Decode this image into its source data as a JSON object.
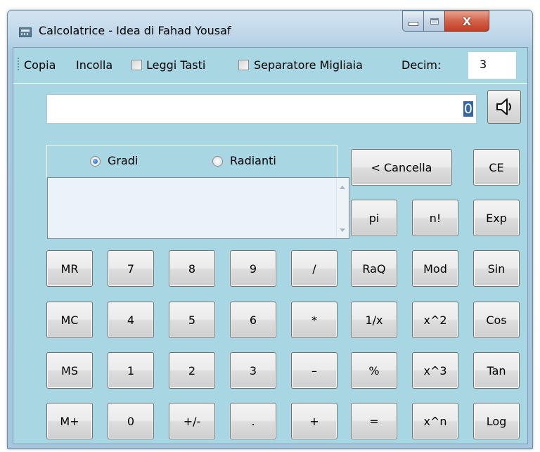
{
  "window": {
    "title": "Calcolatrice - Idea di Fahad Yousaf"
  },
  "window_controls": {
    "minimize_icon": "minimize-icon",
    "maximize_icon": "maximize-icon",
    "close_glyph": "X"
  },
  "toolbar": {
    "copy": "Copia",
    "paste": "Incolla",
    "read_keys": "Leggi Tasti",
    "read_keys_checked": false,
    "thousands_separator": "Separatore Migliaia",
    "thousands_separator_checked": false,
    "decimals_label": "Decim:",
    "decimals_value": "3"
  },
  "display": {
    "value": "0"
  },
  "sound": {
    "icon": "speaker-icon"
  },
  "angle_mode": {
    "degrees": "Gradi",
    "radians": "Radianti",
    "selected": "Gradi"
  },
  "buttons": {
    "backspace": "< Cancella",
    "ce": "CE",
    "pi": "pi",
    "factorial": "n!",
    "exp": "Exp",
    "mr": "MR",
    "mc": "MC",
    "ms": "MS",
    "mplus": "M+",
    "d7": "7",
    "d8": "8",
    "d9": "9",
    "div": "/",
    "d4": "4",
    "d5": "5",
    "d6": "6",
    "mul": "*",
    "d1": "1",
    "d2": "2",
    "d3": "3",
    "sub": "–",
    "d0": "0",
    "sign": "+/-",
    "dot": ".",
    "add": "+",
    "sqrt": "RaQ",
    "mod": "Mod",
    "sin": "Sin",
    "recip": "1/x",
    "sq": "x^2",
    "cos": "Cos",
    "pct": "%",
    "cube": "x^3",
    "tan": "Tan",
    "eq": "=",
    "pow": "x^n",
    "log": "Log"
  }
}
